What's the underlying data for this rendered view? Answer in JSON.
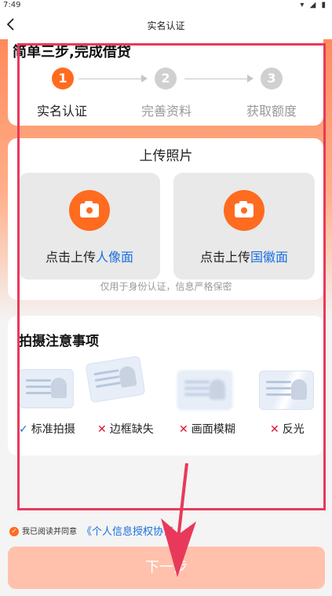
{
  "status_bar": {
    "time": "7:49",
    "icons": "▾ ◢ ▮"
  },
  "nav": {
    "title": "实名认证"
  },
  "steps": {
    "title": "简单三步,完成借贷",
    "items": [
      {
        "number": "1",
        "label": "实名认证",
        "state": "active"
      },
      {
        "number": "2",
        "label": "完善资料",
        "state": "inactive"
      },
      {
        "number": "3",
        "label": "获取额度",
        "state": "inactive"
      }
    ]
  },
  "upload": {
    "title": "上传照片",
    "front": {
      "prefix": "点击上传",
      "highlight": "人像面"
    },
    "back": {
      "prefix": "点击上传",
      "highlight": "国徽面"
    },
    "privacy_note": "仅用于身份认证，信息严格保密"
  },
  "notes": {
    "title": "拍摄注意事项",
    "items": [
      {
        "mark": "✓",
        "label": "标准拍摄",
        "ok": true
      },
      {
        "mark": "✕",
        "label": "边框缺失",
        "ok": false
      },
      {
        "mark": "✕",
        "label": "画面模糊",
        "ok": false
      },
      {
        "mark": "✕",
        "label": "反光",
        "ok": false
      }
    ]
  },
  "agreement": {
    "checkbox": "✓",
    "text": "我已阅读并同意",
    "link": "《个人信息授权协议"
  },
  "next_button": {
    "label": "下一步"
  },
  "colors": {
    "accent": "#ff6b1f",
    "link": "#1a6fe0",
    "annotation": "#e8395a",
    "button_disabled": "#ffc1ac"
  }
}
